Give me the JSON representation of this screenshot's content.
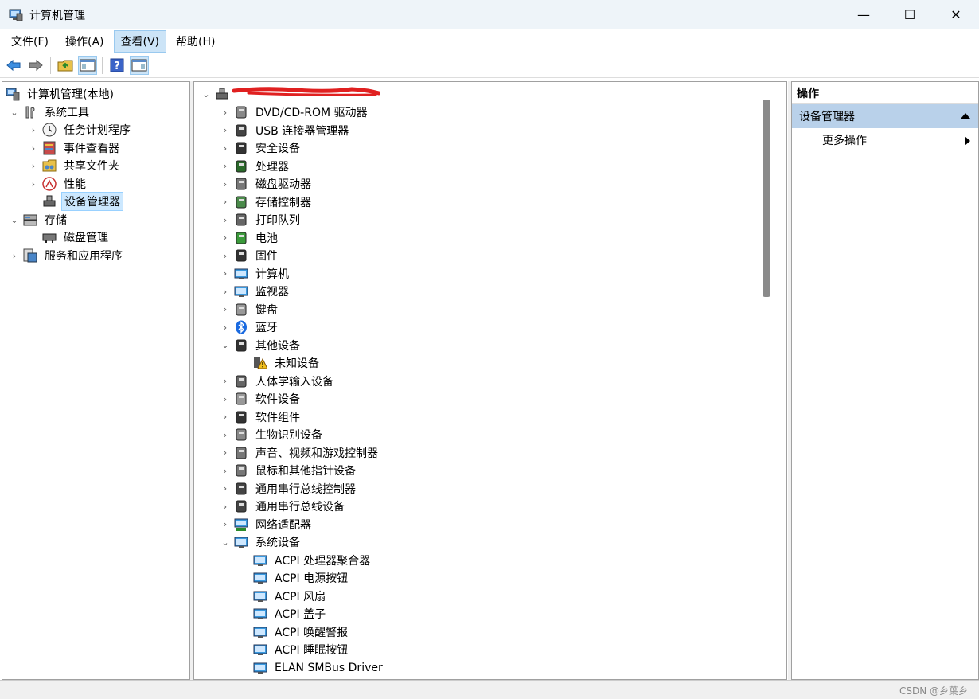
{
  "window": {
    "title": "计算机管理",
    "minimize": "—",
    "maximize": "☐",
    "close": "✕"
  },
  "menu": [
    {
      "label": "文件(F)"
    },
    {
      "label": "操作(A)"
    },
    {
      "label": "查看(V)"
    },
    {
      "label": "帮助(H)"
    }
  ],
  "toolbar": {
    "icons": [
      "back-arrow-icon",
      "forward-arrow-icon",
      "up-folder-icon",
      "show-hide-console-tree-icon",
      "help-icon",
      "show-hide-action-pane-icon"
    ]
  },
  "left_tree": {
    "root": "计算机管理(本地)",
    "system_tools": "系统工具",
    "task_scheduler": "任务计划程序",
    "event_viewer": "事件查看器",
    "shared_folders": "共享文件夹",
    "performance": "性能",
    "device_manager": "设备管理器",
    "storage": "存储",
    "disk_management": "磁盘管理",
    "services_apps": "服务和应用程序"
  },
  "device_tree": {
    "categories": [
      "DVD/CD-ROM 驱动器",
      "USB 连接器管理器",
      "安全设备",
      "处理器",
      "磁盘驱动器",
      "存储控制器",
      "打印队列",
      "电池",
      "固件",
      "计算机",
      "监视器",
      "键盘",
      "蓝牙",
      "其他设备",
      "未知设备",
      "人体学输入设备",
      "软件设备",
      "软件组件",
      "生物识别设备",
      "声音、视频和游戏控制器",
      "鼠标和其他指针设备",
      "通用串行总线控制器",
      "通用串行总线设备",
      "网络适配器",
      "系统设备",
      "ACPI 处理器聚合器",
      "ACPI 电源按钮",
      "ACPI 风扇",
      "ACPI 盖子",
      "ACPI 唤醒警报",
      "ACPI 睡眠按钮",
      "ELAN SMBus Driver"
    ]
  },
  "actions": {
    "header": "操作",
    "section": "设备管理器",
    "more": "更多操作"
  },
  "status": {
    "watermark": "CSDN @乡葉乡"
  }
}
